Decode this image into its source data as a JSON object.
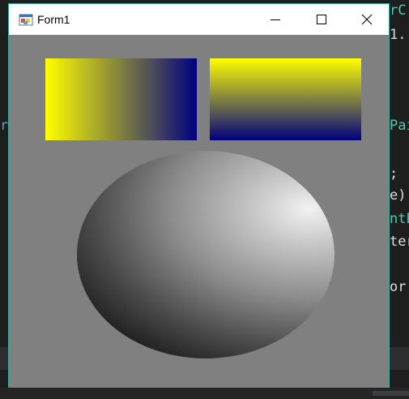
{
  "window": {
    "title": "Form1",
    "border_color": "#2fb0a4",
    "client_color": "#808080"
  },
  "titlebar_buttons": [
    {
      "name": "minimize",
      "icon": "minimize-icon"
    },
    {
      "name": "maximize",
      "icon": "maximize-icon"
    },
    {
      "name": "close",
      "icon": "close-icon"
    }
  ],
  "canvas": {
    "horizontal_gradient": {
      "direction": "left-to-right",
      "colors": [
        "#ffff00",
        "#000080"
      ]
    },
    "vertical_gradient": {
      "direction": "top-to-bottom",
      "colors": [
        "#ffff00",
        "#000080"
      ]
    },
    "sphere": {
      "highlight": "#f2f2f2",
      "shadow": "#000000"
    }
  },
  "background_code": {
    "right_fragments": [
      "rC",
      "1.",
      "Pai",
      ";",
      "e);",
      "ntE",
      "ter",
      "or."
    ],
    "left_fragments": [
      "r"
    ]
  }
}
